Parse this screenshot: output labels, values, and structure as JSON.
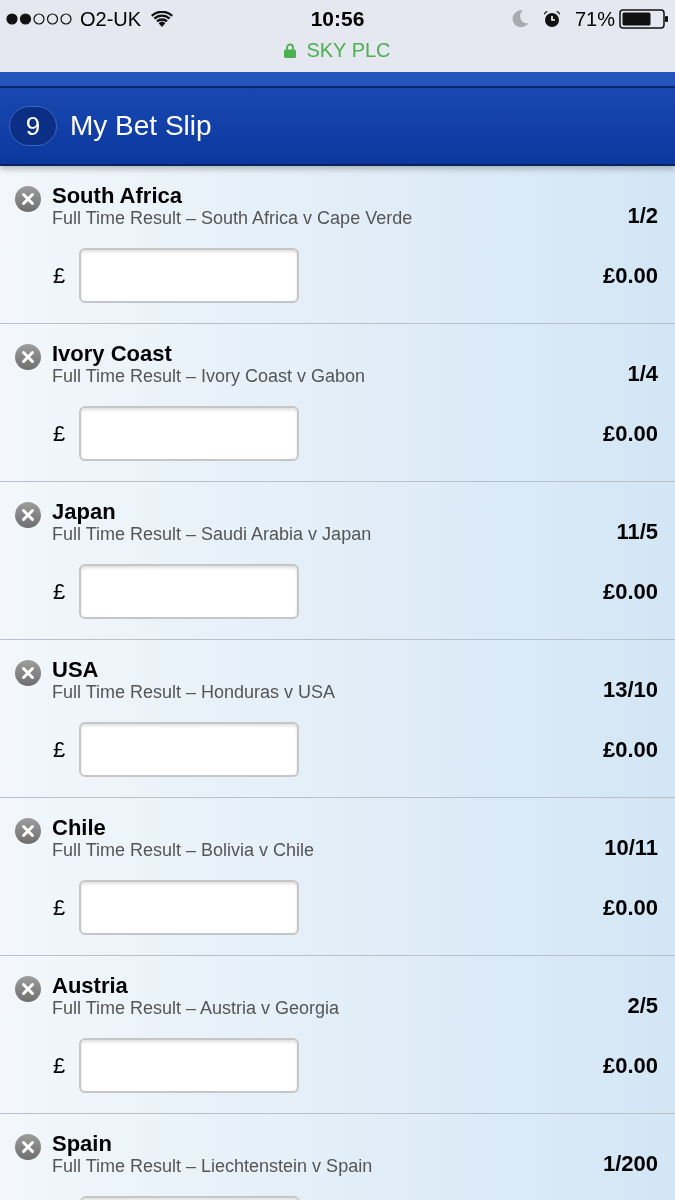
{
  "status_bar": {
    "carrier": "O2-UK",
    "time": "10:56",
    "battery": "71%",
    "site": "SKY PLC"
  },
  "header": {
    "count": "9",
    "title": "My Bet Slip"
  },
  "bets": [
    {
      "selection": "South Africa",
      "market": "Full Time Result – South Africa v Cape Verde",
      "odds": "1/2",
      "currency": "£",
      "returns": "£0.00"
    },
    {
      "selection": "Ivory Coast",
      "market": "Full Time Result – Ivory Coast v Gabon",
      "odds": "1/4",
      "currency": "£",
      "returns": "£0.00"
    },
    {
      "selection": "Japan",
      "market": "Full Time Result – Saudi Arabia v Japan",
      "odds": "11/5",
      "currency": "£",
      "returns": "£0.00"
    },
    {
      "selection": "USA",
      "market": "Full Time Result – Honduras v USA",
      "odds": "13/10",
      "currency": "£",
      "returns": "£0.00"
    },
    {
      "selection": "Chile",
      "market": "Full Time Result – Bolivia v Chile",
      "odds": "10/11",
      "currency": "£",
      "returns": "£0.00"
    },
    {
      "selection": "Austria",
      "market": "Full Time Result – Austria v Georgia",
      "odds": "2/5",
      "currency": "£",
      "returns": "£0.00"
    },
    {
      "selection": "Spain",
      "market": "Full Time Result – Liechtenstein v Spain",
      "odds": "1/200"
    }
  ]
}
